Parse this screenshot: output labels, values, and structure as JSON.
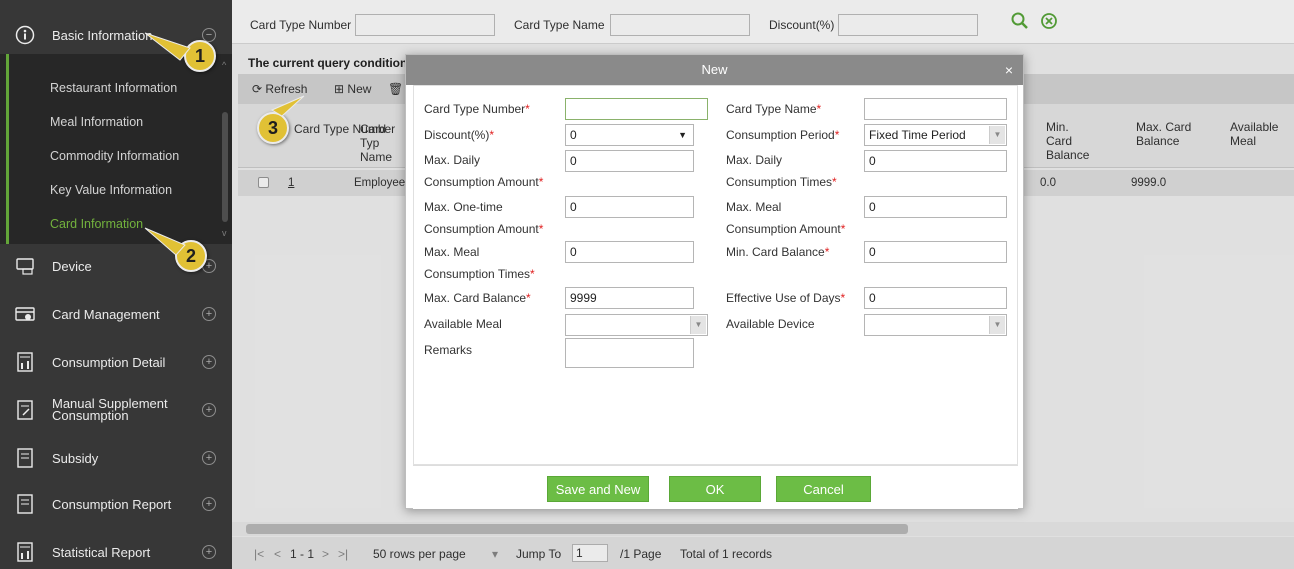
{
  "sidebar": {
    "basic_information": "Basic Information",
    "sub_items": [
      "Restaurant Information",
      "Meal Information",
      "Commodity Information",
      "Key Value Information",
      "Card Information"
    ],
    "device": "Device",
    "card_management": "Card Management",
    "consumption_detail": "Consumption Detail",
    "manual_supplement_line1": "Manual Supplement",
    "manual_supplement_line2": "Consumption",
    "subsidy": "Subsidy",
    "consumption_report": "Consumption Report",
    "statistical_report": "Statistical Report"
  },
  "query": {
    "card_type_number_label": "Card Type Number",
    "card_type_name_label": "Card Type Name",
    "discount_label": "Discount(%)",
    "current_conditions": "The current query conditions"
  },
  "toolbar": {
    "refresh": "Refresh",
    "new": "New"
  },
  "grid": {
    "headers": [
      "Card Type Number",
      "Card Typ Name",
      "Min. Card Balance",
      "Max. Card Balance",
      "Available Meal"
    ],
    "row": {
      "number": "1",
      "name": "Employee",
      "min_balance": "0.0",
      "max_balance": "9999.0"
    }
  },
  "pager": {
    "range": "1 - 1",
    "rows_per_page": "50 rows per page",
    "jump_to": "Jump To",
    "page_value": "1",
    "page_total": "/1 Page",
    "total_records": "Total of 1 records"
  },
  "callouts": [
    "1",
    "2",
    "3"
  ],
  "modal": {
    "title": "New",
    "fields": {
      "card_type_number": {
        "label": "Card Type Number",
        "value": ""
      },
      "card_type_name": {
        "label": "Card Type Name",
        "value": ""
      },
      "discount": {
        "label": "Discount(%)",
        "value": "0"
      },
      "consumption_period": {
        "label": "Consumption Period",
        "value": "Fixed Time Period"
      },
      "max_daily_amount": {
        "label1": "Max. Daily",
        "label2": "Consumption Amount",
        "value": "0"
      },
      "max_daily_times": {
        "label1": "Max. Daily",
        "label2": "Consumption Times",
        "value": "0"
      },
      "max_one_time": {
        "label1": "Max. One-time",
        "label2": "Consumption Amount",
        "value": "0"
      },
      "max_meal_amount": {
        "label1": "Max. Meal",
        "label2": "Consumption Amount",
        "value": "0"
      },
      "max_meal_times": {
        "label1": "Max. Meal",
        "label2": "Consumption Times",
        "value": "0"
      },
      "min_card_balance": {
        "label": "Min. Card Balance",
        "value": "0"
      },
      "max_card_balance": {
        "label": "Max. Card Balance",
        "value": "9999"
      },
      "effective_days": {
        "label": "Effective Use of Days",
        "value": "0"
      },
      "available_meal": {
        "label": "Available Meal",
        "value": ""
      },
      "available_device": {
        "label": "Available Device",
        "value": ""
      },
      "remarks": {
        "label": "Remarks",
        "value": ""
      }
    },
    "buttons": {
      "save_and_new": "Save and New",
      "ok": "OK",
      "cancel": "Cancel"
    },
    "required_marker": "*",
    "close_glyph": "×"
  },
  "colors": {
    "sidebar_bg": "#3c3c3c",
    "accent_green": "#6cbd45",
    "active_item": "#7cc043",
    "callout": "#f5d23a",
    "required": "#e02020"
  }
}
